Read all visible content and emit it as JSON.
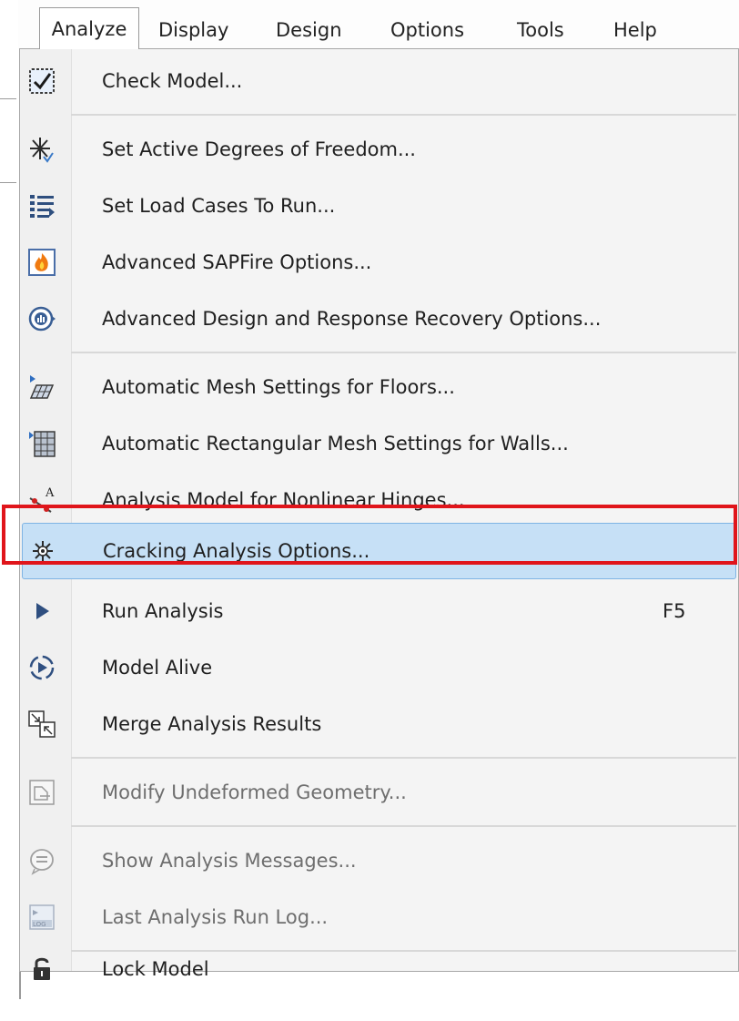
{
  "menubar": {
    "items": [
      "Analyze",
      "Display",
      "Design",
      "Options",
      "Tools",
      "Help"
    ]
  },
  "menu": {
    "items": [
      {
        "label": "Check Model...",
        "icon": "check-icon"
      },
      {
        "label": "Set Active Degrees of Freedom...",
        "icon": "degrees-of-freedom-icon"
      },
      {
        "label": "Set Load Cases To Run...",
        "icon": "load-cases-list-icon"
      },
      {
        "label": "Advanced SAPFire Options...",
        "icon": "sapfire-icon"
      },
      {
        "label": "Advanced Design and Response Recovery Options...",
        "icon": "response-recovery-icon"
      },
      {
        "label": "Automatic Mesh Settings for Floors...",
        "icon": "floor-mesh-icon"
      },
      {
        "label": "Automatic Rectangular Mesh Settings for Walls...",
        "icon": "wall-mesh-icon"
      },
      {
        "label": "Analysis Model for Nonlinear Hinges...",
        "icon": "nonlinear-hinge-icon"
      },
      {
        "label": "Cracking Analysis Options...",
        "icon": "cracking-icon",
        "highlighted": true
      },
      {
        "label": "Run Analysis",
        "icon": "run-icon",
        "shortcut": "F5"
      },
      {
        "label": "Model Alive",
        "icon": "model-alive-icon"
      },
      {
        "label": "Merge Analysis Results",
        "icon": "merge-results-icon"
      },
      {
        "label": "Modify Undeformed Geometry...",
        "icon": "modify-geometry-icon",
        "disabled": true
      },
      {
        "label": "Show Analysis Messages...",
        "icon": "messages-icon",
        "disabled": true
      },
      {
        "label": "Last Analysis Run Log...",
        "icon": "run-log-icon",
        "disabled": true
      },
      {
        "label": "Lock Model",
        "icon": "lock-icon"
      }
    ]
  },
  "colors": {
    "highlight": "#c6e0f6",
    "annotation_box": "#e0151b"
  }
}
